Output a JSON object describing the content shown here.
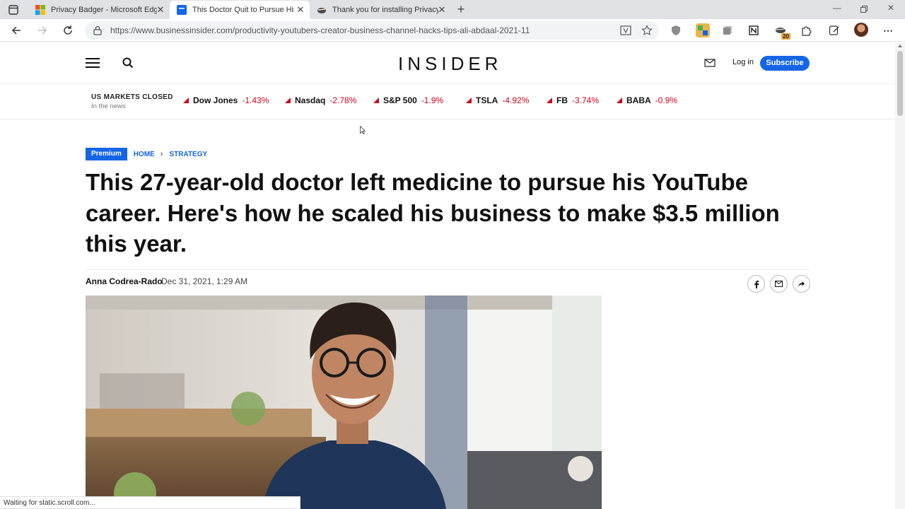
{
  "browser": {
    "tabs": [
      {
        "title": "Privacy Badger - Microsoft Edge",
        "active": false
      },
      {
        "title": "This Doctor Quit to Pursue His YouTube",
        "active": true
      },
      {
        "title": "Thank you for installing Privacy Badger",
        "active": false
      }
    ],
    "url": "https://www.businessinsider.com/productivity-youtubers-creator-business-channel-hacks-tips-ali-abdaal-2021-11",
    "extension_badge": "20",
    "status_text": "Waiting for static.scroll.com..."
  },
  "site": {
    "logo": "INSIDER",
    "login_label": "Log in",
    "subscribe_label": "Subscribe"
  },
  "markets": {
    "status": "US MARKETS CLOSED",
    "substatus": "In the news",
    "tickers": [
      {
        "name": "Dow Jones",
        "change": "-1.43%"
      },
      {
        "name": "Nasdaq",
        "change": "-2.78%"
      },
      {
        "name": "S&P 500",
        "change": "-1.9%"
      },
      {
        "name": "TSLA",
        "change": "-4.92%"
      },
      {
        "name": "FB",
        "change": "-3.74%"
      },
      {
        "name": "BABA",
        "change": "-0.9%"
      }
    ]
  },
  "article": {
    "premium_label": "Premium",
    "breadcrumb": [
      "HOME",
      "STRATEGY"
    ],
    "breadcrumb_sep": "›",
    "headline": "This 27-year-old doctor left medicine to pursue his YouTube career. Here's how he scaled his business to make $3.5 million this year.",
    "author": "Anna Codrea-Rado",
    "date": "Dec 31, 2021, 1:29 AM"
  },
  "colors": {
    "accent": "#1565e5",
    "negative": "#d0021b"
  }
}
